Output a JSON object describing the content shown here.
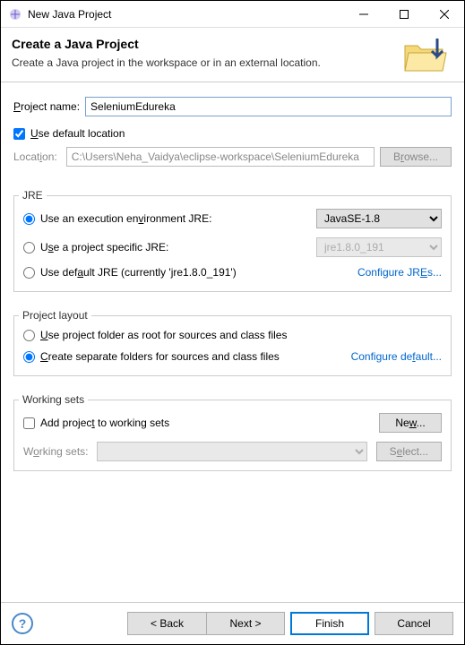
{
  "titlebar": {
    "text": "New Java Project"
  },
  "header": {
    "title": "Create a Java Project",
    "desc": "Create a Java project in the workspace or in an external location."
  },
  "project": {
    "name_label_pre": "",
    "name_label_u": "P",
    "name_label_post": "roject name:",
    "name_value": "SeleniumEdureka",
    "use_default_pre": "",
    "use_default_u": "U",
    "use_default_post": "se default location",
    "location_label_pre": "Locat",
    "location_label_u": "i",
    "location_label_post": "on:",
    "location_value": "C:\\Users\\Neha_Vaidya\\eclipse-workspace\\SeleniumEdureka",
    "browse_pre": "B",
    "browse_u": "r",
    "browse_post": "owse..."
  },
  "jre": {
    "group_label": "JRE",
    "opt1_pre": "Use an execution en",
    "opt1_u": "v",
    "opt1_post": "ironment JRE:",
    "opt1_value": "JavaSE-1.8",
    "opt2_pre": "U",
    "opt2_u": "s",
    "opt2_post": "e a project specific JRE:",
    "opt2_value": "jre1.8.0_191",
    "opt3_pre": "Use def",
    "opt3_u": "a",
    "opt3_post": "ult JRE (currently 'jre1.8.0_191')",
    "link_pre": "Configure JR",
    "link_u": "E",
    "link_post": "s..."
  },
  "layout": {
    "group_label": "Project layout",
    "opt1_pre": "",
    "opt1_u": "U",
    "opt1_post": "se project folder as root for sources and class files",
    "opt2_pre": "",
    "opt2_u": "C",
    "opt2_post": "reate separate folders for sources and class files",
    "link_pre": "Configure de",
    "link_u": "f",
    "link_post": "ault..."
  },
  "ws": {
    "group_label": "Working sets",
    "add_pre": "Add projec",
    "add_u": "t",
    "add_post": " to working sets",
    "new_pre": "Ne",
    "new_u": "w",
    "new_post": "...",
    "list_label_pre": "W",
    "list_label_u": "o",
    "list_label_post": "rking sets:",
    "select_pre": "S",
    "select_u": "e",
    "select_post": "lect..."
  },
  "footer": {
    "back": "< Back",
    "next": "Next >",
    "finish": "Finish",
    "cancel": "Cancel"
  }
}
